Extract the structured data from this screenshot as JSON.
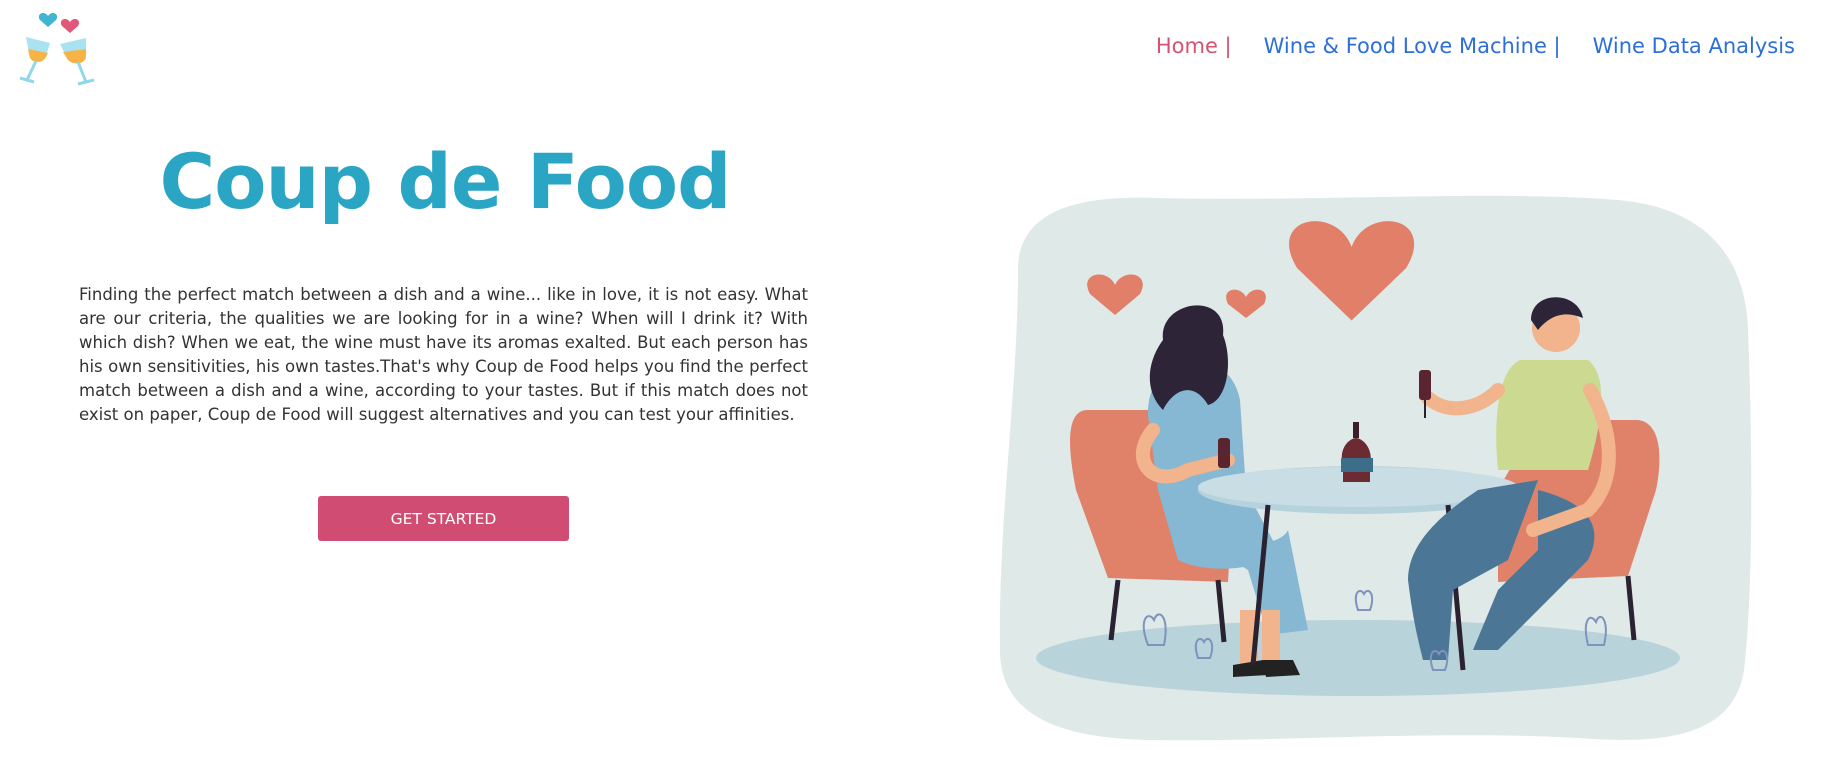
{
  "nav": {
    "items": [
      {
        "label": "Home |",
        "active": true
      },
      {
        "label": "Wine & Food Love Machine |",
        "active": false
      },
      {
        "label": "Wine Data Analysis",
        "active": false
      }
    ]
  },
  "hero": {
    "title": "Coup de Food",
    "description": "Finding the perfect match between a dish and a wine... like in love, it is not easy. What are our criteria, the qualities we are looking for in a wine? When will I drink it? With which dish? When we eat, the wine must have its aromas exalted. But each person has his own sensitivities, his own tastes.That's why Coup de Food helps you find the perfect match between a dish and a wine, according to your tastes. But if this match does not exist on paper, Coup de Food will suggest alternatives and you can test your affinities.",
    "cta_label": "GET STARTED"
  },
  "colors": {
    "brand_teal": "#2aa6c4",
    "accent_pink": "#d14c72",
    "nav_link": "#2c6fd8",
    "nav_active": "#d4546f"
  },
  "icons": {
    "logo": "wine-glasses-cheers-icon",
    "illustration": "couple-dinner-illustration"
  }
}
